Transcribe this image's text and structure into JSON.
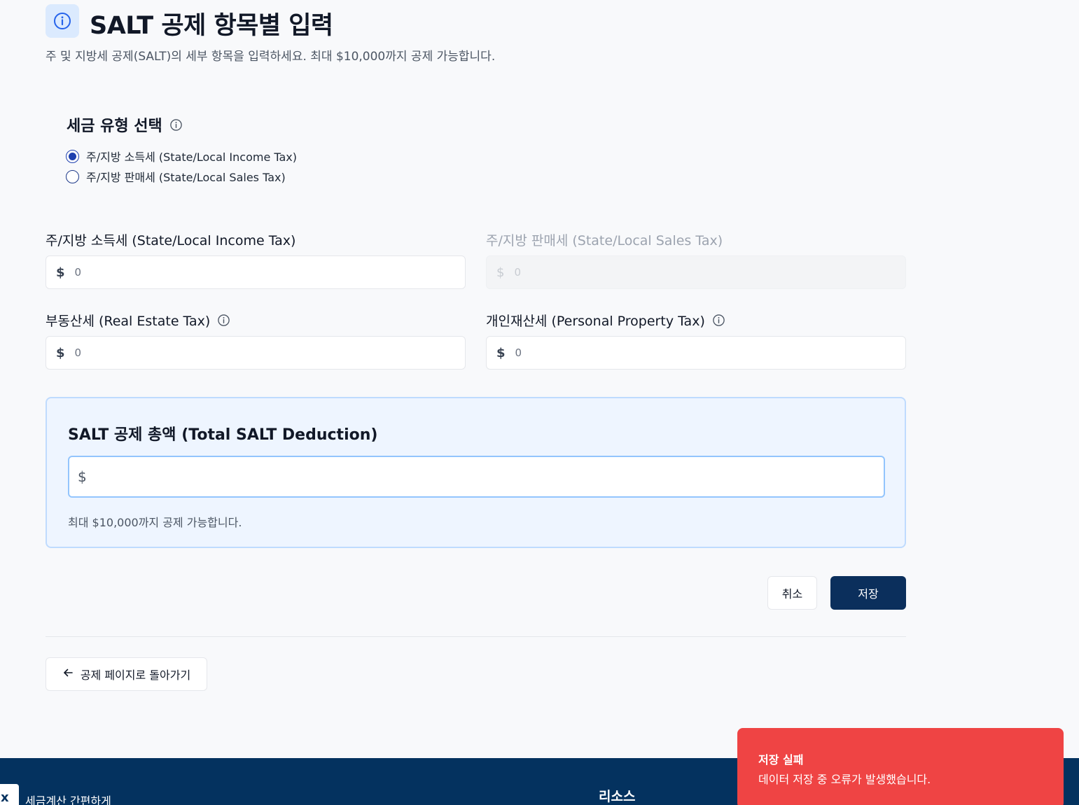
{
  "header": {
    "title": "SALT 공제 항목별 입력",
    "subtitle": "주 및 지방세 공제(SALT)의 세부 항목을 입력하세요. 최대 $10,000까지 공제 가능합니다.",
    "icon": "info-icon",
    "accent": "#2563eb"
  },
  "tax_type": {
    "title": "세금 유형 선택",
    "options": [
      {
        "label": "주/지방 소득세 (State/Local Income Tax)",
        "selected": true
      },
      {
        "label": "주/지방 판매세 (State/Local Sales Tax)",
        "selected": false
      }
    ]
  },
  "fields": {
    "income_tax": {
      "label": "주/지방 소득세 (State/Local Income Tax)",
      "currency": "$",
      "value": "0",
      "disabled": false
    },
    "sales_tax": {
      "label": "주/지방 판매세 (State/Local Sales Tax)",
      "currency": "$",
      "value": "0",
      "disabled": true
    },
    "real_estate_tax": {
      "label": "부동산세 (Real Estate Tax)",
      "currency": "$",
      "value": "0"
    },
    "personal_property_tax": {
      "label": "개인재산세 (Personal Property Tax)",
      "currency": "$",
      "value": "0"
    }
  },
  "total": {
    "title": "SALT 공제 총액 (Total SALT Deduction)",
    "currency": "$",
    "value": "",
    "note": "최대 $10,000까지 공제 가능합니다."
  },
  "actions": {
    "cancel_label": "취소",
    "save_label": "저장",
    "back_label": "공제 페이지로 돌아가기",
    "save_color": "#0b2f5c"
  },
  "footer": {
    "logo_text": "x",
    "tagline": "세금계산 간편하게",
    "resources_heading": "리소스",
    "bg_color": "#04325f"
  },
  "toast": {
    "title": "저장 실패",
    "message": "데이터 저장 중 오류가 발생했습니다.",
    "color": "#ef4444"
  }
}
